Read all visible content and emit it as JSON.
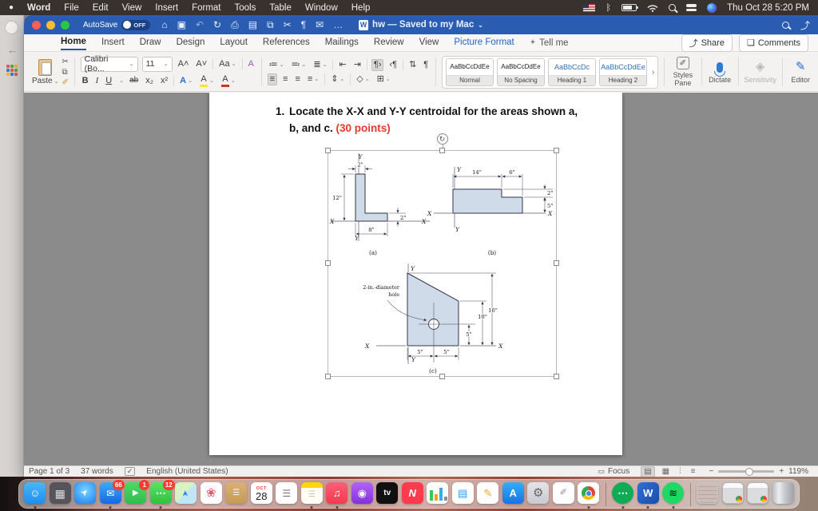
{
  "menubar": {
    "apple_icon": "●",
    "items": [
      "Word",
      "File",
      "Edit",
      "View",
      "Insert",
      "Format",
      "Tools",
      "Table",
      "Window",
      "Help"
    ],
    "clock": "Thu Oct 28 5:20 PM"
  },
  "titlebar": {
    "autosave_label": "AutoSave",
    "autosave_state": "OFF",
    "doc_icon": "W",
    "title": "hw — Saved to my Mac",
    "title_chevron": "⌄"
  },
  "tabs": {
    "back_icon": "←",
    "items": [
      "Home",
      "Insert",
      "Draw",
      "Design",
      "Layout",
      "References",
      "Mailings",
      "Review",
      "View"
    ],
    "contextual": "Picture Format",
    "tellme_icon": "✦",
    "tellme_label": "Tell me",
    "share_icon": "⤴",
    "share_label": "Share",
    "comments_icon": "❑",
    "comments_label": "Comments"
  },
  "icons": {
    "home": "⌂",
    "save": "▣",
    "undo": "↶",
    "redo": "↻",
    "print": "⎙",
    "draft": "▤",
    "copy": "⧉",
    "cut": "✂",
    "marks": "¶",
    "mail": "✉",
    "more": "…",
    "chevron": "⌄",
    "grow": "A˄",
    "shrink": "A˅",
    "case": "Aa",
    "clear": "A",
    "bold": "B",
    "italic": "I",
    "underline": "U",
    "strike": "ab",
    "sub": "x₂",
    "sup": "x²",
    "fx": "A",
    "hl": "A",
    "fc": "A",
    "brush": "✐",
    "bullets": "≔",
    "numbering": "≕",
    "multilevel": "≣",
    "outdent": "⇤",
    "indent": "⇥",
    "ltr": "¶›",
    "rtl": "‹¶",
    "sort": "⇅",
    "pilcrow": "¶",
    "align": "≡",
    "spacing": "⇕",
    "shading": "◇",
    "borders": "⊞",
    "next": "›",
    "styles_pane": "❏",
    "sensitivity": "◈",
    "editor": "✎",
    "rotate": "↻",
    "focus": "▭",
    "proof": "✓",
    "view1": "▤",
    "view2": "▦",
    "view3": "⫶",
    "view4": "≡",
    "minus": "−",
    "plus": "+"
  },
  "ribbon": {
    "paste_label": "Paste",
    "font_name": "Calibri (Bo...",
    "font_size": "11",
    "styles": [
      {
        "preview": "AaBbCcDdEe",
        "name": "Normal"
      },
      {
        "preview": "AaBbCcDdEe",
        "name": "No Spacing"
      },
      {
        "preview": "AaBbCcDc",
        "name": "Heading 1"
      },
      {
        "preview": "AaBbCcDdEe",
        "name": "Heading 2"
      }
    ],
    "styles_pane_label": "Styles Pane",
    "dictate_label": "Dictate",
    "sensitivity_label": "Sensitivity",
    "editor_label": "Editor"
  },
  "document": {
    "heading_num": "1.",
    "heading_text": "Locate the X-X and Y-Y centroidal for the areas shown a,",
    "heading_line2": "b, and c. ",
    "heading_points": "(30 points)",
    "fig_a": {
      "y_top": "Y",
      "y_bottom": "Y",
      "x_left": "X",
      "x_right": "X",
      "dim_top": "2\"",
      "dim_left": "12\"",
      "dim_bottom": "8\"",
      "dim_right": "2\"",
      "caption": "(a)"
    },
    "fig_b": {
      "y_top": "Y",
      "y_bottom": "Y",
      "x_left": "X",
      "x_right": "X",
      "dim_top_left": "14\"",
      "dim_top_right": "6\"",
      "dim_right_upper": "2\"",
      "dim_right_lower": "5\"",
      "caption": "(b)"
    },
    "fig_c": {
      "y_top": "Y",
      "y_bottom": "Y",
      "x_left": "X",
      "x_right": "X",
      "hole_label_line1": "2-in.-diameter",
      "hole_label_line2": "hole",
      "dim_right_outer": "16\"",
      "dim_right_mid": "10\"",
      "dim_right_inner": "5\"",
      "dim_bottom_left": "5\"",
      "dim_bottom_right": "5\"",
      "caption": "(c)"
    }
  },
  "statusbar": {
    "page": "Page 1 of 3",
    "words": "37 words",
    "language": "English (United States)",
    "focus_label": "Focus",
    "zoom_value": "119%"
  },
  "dock": {
    "items": [
      {
        "name": "finder",
        "cls": "t-finder",
        "glyph": "☺",
        "dot": true
      },
      {
        "name": "launchpad",
        "cls": "t-launchpad",
        "glyph": "▦"
      },
      {
        "name": "safari",
        "cls": "t-safari",
        "glyph": "➤"
      },
      {
        "name": "mail",
        "cls": "t-mail",
        "glyph": "✉",
        "badge": "66",
        "dot": true
      },
      {
        "name": "facetime",
        "cls": "t-facetime",
        "glyph": "▶",
        "badge": "1"
      },
      {
        "name": "messages",
        "cls": "t-messages",
        "glyph": "⋯",
        "badge": "12",
        "dot": true
      },
      {
        "name": "maps",
        "cls": "t-maps",
        "glyph": "➤"
      },
      {
        "name": "photos",
        "cls": "t-photos",
        "glyph": "❀"
      },
      {
        "name": "contacts",
        "cls": "t-contacts",
        "glyph": "☰"
      },
      {
        "name": "calendar",
        "cls": "t-calendar",
        "cal_top": "OCT",
        "cal_day": "28"
      },
      {
        "name": "reminders",
        "cls": "t-reminders",
        "glyph": "☰"
      },
      {
        "name": "notes",
        "cls": "t-notes",
        "glyph": "☰",
        "dot": true
      },
      {
        "name": "music",
        "cls": "t-music",
        "glyph": "♫",
        "dot": true
      },
      {
        "name": "podcasts",
        "cls": "t-podcasts",
        "glyph": "◉"
      },
      {
        "name": "tv",
        "cls": "t-tv",
        "glyph": "tv"
      },
      {
        "name": "news",
        "cls": "t-news",
        "glyph": "N"
      },
      {
        "name": "numbers",
        "cls": "t-numbers",
        "glyph": ""
      },
      {
        "name": "keynote",
        "cls": "t-keynote",
        "glyph": "▤"
      },
      {
        "name": "pages",
        "cls": "t-pages",
        "glyph": "✎"
      },
      {
        "name": "appstore",
        "cls": "t-appstore",
        "glyph": "A"
      },
      {
        "name": "settings",
        "cls": "t-settings",
        "glyph": "⚙"
      },
      {
        "name": "textedit",
        "cls": "t-textedit",
        "glyph": "✐"
      },
      {
        "name": "chrome",
        "cls": "t-chrome",
        "chrome": true,
        "dot": true
      },
      {
        "sep": true
      },
      {
        "name": "hangouts",
        "cls": "t-hangouts round",
        "glyph": "⋯",
        "dot": true
      },
      {
        "name": "word",
        "cls": "t-word",
        "glyph": "W",
        "dot": true
      },
      {
        "name": "spotify",
        "cls": "t-spotify round",
        "glyph": "≋",
        "dot": true
      },
      {
        "sep": true
      },
      {
        "name": "downloads-stack",
        "cls": "t-docstack",
        "glyph": ""
      },
      {
        "name": "window-thumb-1",
        "cls": "t-thumb",
        "glyph": ""
      },
      {
        "name": "window-thumb-2",
        "cls": "t-thumb",
        "glyph": ""
      },
      {
        "name": "trash",
        "cls": "t-trash",
        "glyph": ""
      }
    ]
  }
}
